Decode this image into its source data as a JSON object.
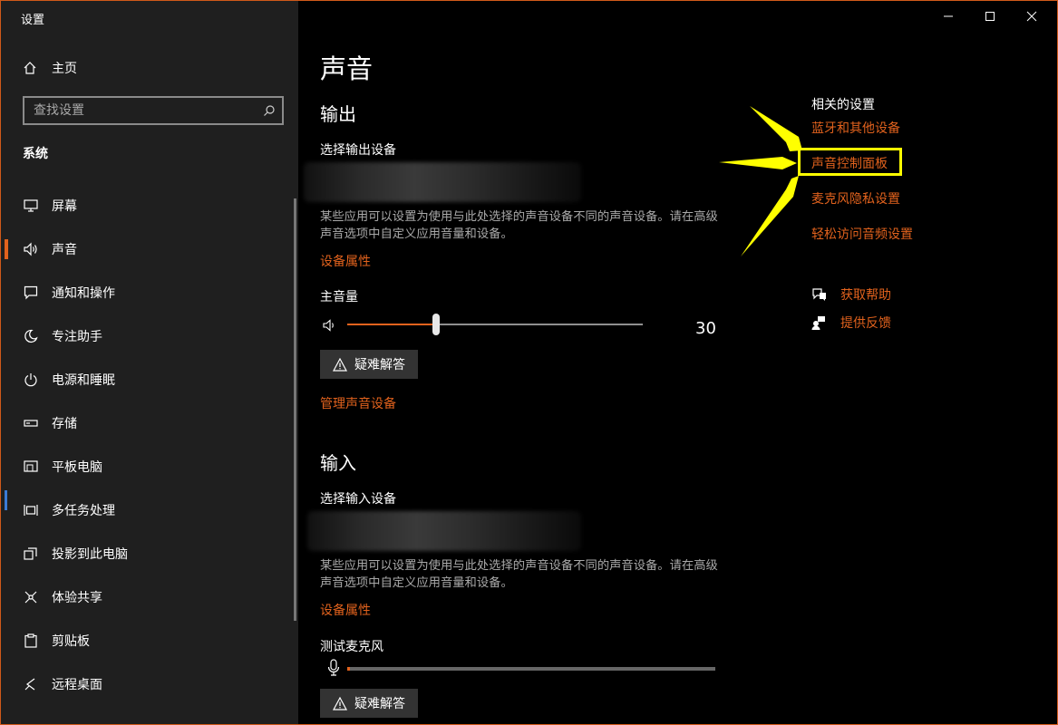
{
  "window": {
    "title": "设置",
    "controls": {
      "minimize": "minimize-icon",
      "maximize": "maximize-icon",
      "close": "close-icon"
    }
  },
  "sidebar": {
    "home_label": "主页",
    "search_placeholder": "查找设置",
    "section_title": "系统",
    "items": [
      {
        "label": "屏幕",
        "icon": "monitor-icon"
      },
      {
        "label": "声音",
        "icon": "speaker-icon",
        "selected": true
      },
      {
        "label": "通知和操作",
        "icon": "notification-icon"
      },
      {
        "label": "专注助手",
        "icon": "moon-icon"
      },
      {
        "label": "电源和睡眠",
        "icon": "power-icon"
      },
      {
        "label": "存储",
        "icon": "storage-icon"
      },
      {
        "label": "平板电脑",
        "icon": "tablet-icon"
      },
      {
        "label": "多任务处理",
        "icon": "multitask-icon"
      },
      {
        "label": "投影到此电脑",
        "icon": "project-icon"
      },
      {
        "label": "体验共享",
        "icon": "share-icon"
      },
      {
        "label": "剪贴板",
        "icon": "clipboard-icon"
      },
      {
        "label": "远程桌面",
        "icon": "remote-desktop-icon"
      }
    ]
  },
  "main": {
    "page_title": "声音",
    "output": {
      "heading": "输出",
      "device_label": "选择输出设备",
      "description": "某些应用可以设置为使用与此处选择的声音设备不同的声音设备。请在高级声音选项中自定义应用音量和设备。",
      "properties_link": "设备属性",
      "volume_label": "主音量",
      "volume_value": "30",
      "volume_fraction": 0.3,
      "troubleshoot_label": "疑难解答",
      "manage_link": "管理声音设备"
    },
    "input": {
      "heading": "输入",
      "device_label": "选择输入设备",
      "description": "某些应用可以设置为使用与此处选择的声音设备不同的声音设备。请在高级声音选项中自定义应用音量和设备。",
      "properties_link": "设备属性",
      "test_mic_label": "测试麦克风",
      "troubleshoot_label": "疑难解答"
    }
  },
  "related": {
    "title": "相关的设置",
    "links": [
      "蓝牙和其他设备",
      "声音控制面板",
      "麦克风隐私设置",
      "轻松访问音频设置"
    ],
    "help_label": "获取帮助",
    "feedback_label": "提供反馈"
  },
  "colors": {
    "accent": "#e1621d",
    "highlight": "#ffff00",
    "sidebar_bg": "#1f1f1f",
    "main_bg": "#000000"
  }
}
